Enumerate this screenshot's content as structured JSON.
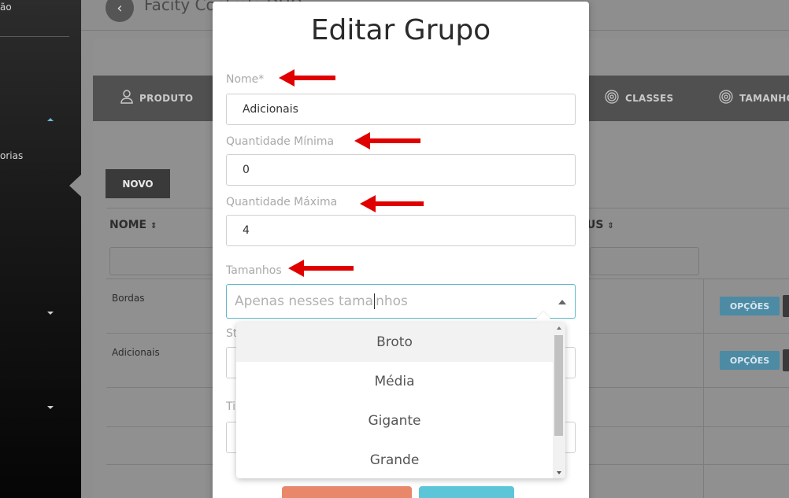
{
  "sidebar": {
    "item_top": "ão",
    "item_mid": "orias"
  },
  "header": {
    "title": "Facity Controle DUO"
  },
  "tabs": [
    {
      "label": "PRODUTO",
      "icon": "user-icon"
    },
    {
      "label": "CLASSES",
      "icon": "fingerprint-icon"
    },
    {
      "label": "TAMANHO",
      "icon": "fingerprint-icon"
    }
  ],
  "toolbar": {
    "novo_label": "NOVO"
  },
  "table": {
    "col_nome": "NOME",
    "col_status": "US",
    "rows": [
      {
        "nome": "Bordas",
        "action": "OPÇÕES"
      },
      {
        "nome": "Adicionais",
        "action": "OPÇÕES"
      }
    ]
  },
  "modal": {
    "title": "Editar Grupo",
    "nome_label": "Nome*",
    "nome_value": "Adicionais",
    "qmin_label": "Quantidade Mínima",
    "qmin_value": "0",
    "qmax_label": "Quantidade Máxima",
    "qmax_value": "4",
    "tamanhos_label": "Tamanhos",
    "tamanhos_placeholder_a": "Apenas nesses tama",
    "tamanhos_placeholder_b": "nhos",
    "hidden_label_1": "St",
    "hidden_label_2": "Ti"
  },
  "dropdown": {
    "options": [
      "Broto",
      "Média",
      "Gigante",
      "Grande"
    ]
  },
  "colors": {
    "accent": "#5fb8c8",
    "annotation": "#e00000",
    "options_button": "#4d8aa4"
  }
}
